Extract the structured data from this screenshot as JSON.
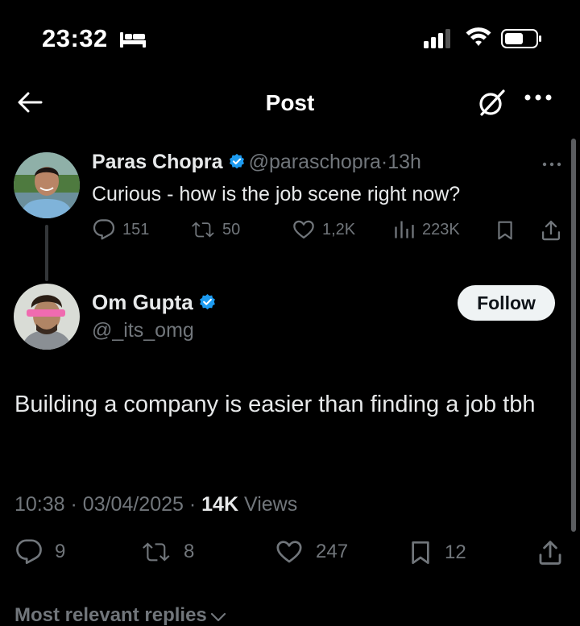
{
  "status_bar": {
    "time": "23:32",
    "icons": [
      "bed-icon",
      "signal-icon",
      "wifi-icon",
      "battery-icon"
    ]
  },
  "nav": {
    "title": "Post",
    "icons": [
      "back-arrow-icon",
      "grok-icon",
      "more-icon"
    ]
  },
  "parent_tweet": {
    "name": "Paras Chopra",
    "handle": "@paraschopra",
    "separator": "·",
    "time": "13h",
    "text": "Curious - how is the job scene right now?",
    "replies": "151",
    "reposts": "50",
    "likes": "1,2K",
    "views": "223K"
  },
  "reply": {
    "name": "Om Gupta",
    "handle": "@_its_omg",
    "follow_label": "Follow",
    "text": "Building a company is easier than finding a job tbh",
    "time": "10:38",
    "date": "03/04/2025",
    "views_count": "14K",
    "views_label": "Views",
    "replies": "9",
    "reposts": "8",
    "likes": "247",
    "bookmarks": "12"
  },
  "replies_sort_label": "Most relevant replies",
  "colors": {
    "background": "#000000",
    "text": "#e7e9ea",
    "muted": "#71767b",
    "verified": "#1d9bf0",
    "follow_bg": "#eff3f4"
  }
}
